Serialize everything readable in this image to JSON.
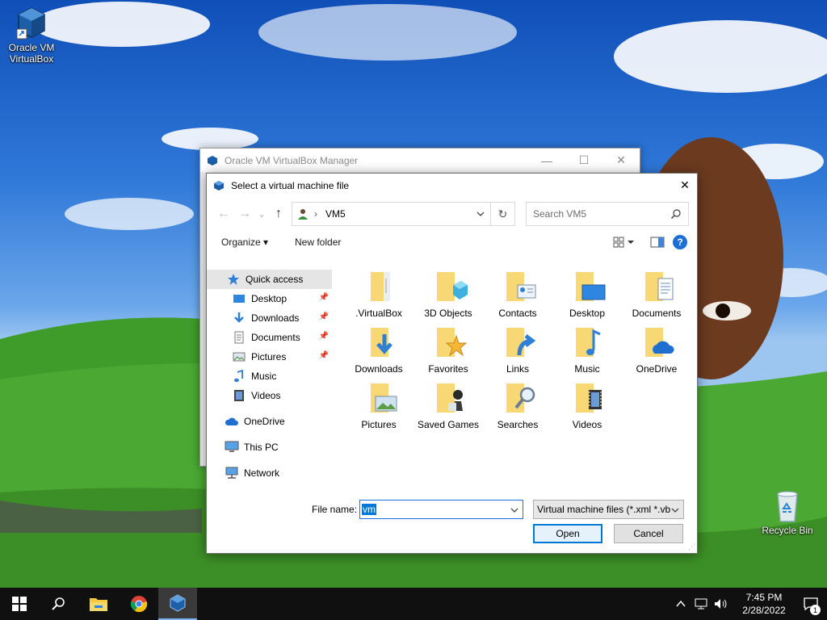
{
  "desktop": {
    "icons": [
      {
        "label": "Oracle VM VirtualBox",
        "icon": "virtualbox-icon"
      },
      {
        "label": "Recycle Bin",
        "icon": "recycle-bin-icon"
      }
    ]
  },
  "back_window": {
    "title": "Oracle VM VirtualBox Manager",
    "controls": {
      "minimize": "—",
      "maximize": "☐",
      "close": "✕"
    }
  },
  "dialog": {
    "title": "Select a virtual machine file",
    "close": "✕",
    "nav": {
      "back": "←",
      "forward": "→",
      "recent": "⌄",
      "up": "↑"
    },
    "address": {
      "separator": "›",
      "path": "VM5",
      "refresh": "↻"
    },
    "search": {
      "placeholder": "Search VM5"
    },
    "commands": {
      "organize": "Organize ▾",
      "new_folder": "New folder"
    },
    "nav_pane": [
      {
        "label": "Quick access",
        "icon": "star-icon",
        "pinned": false
      },
      {
        "label": "Desktop",
        "icon": "desktop-icon",
        "pinned": true
      },
      {
        "label": "Downloads",
        "icon": "download-icon",
        "pinned": true
      },
      {
        "label": "Documents",
        "icon": "document-icon",
        "pinned": true
      },
      {
        "label": "Pictures",
        "icon": "picture-icon",
        "pinned": true
      },
      {
        "label": "Music",
        "icon": "music-icon",
        "pinned": false
      },
      {
        "label": "Videos",
        "icon": "video-icon",
        "pinned": false
      },
      {
        "label": "OneDrive",
        "icon": "cloud-icon",
        "pinned": false
      },
      {
        "label": "This PC",
        "icon": "computer-icon",
        "pinned": false
      },
      {
        "label": "Network",
        "icon": "network-icon",
        "pinned": false
      }
    ],
    "folders": [
      {
        "label": ".VirtualBox",
        "icon": "folder-icon"
      },
      {
        "label": "3D Objects",
        "icon": "3d-objects-folder-icon"
      },
      {
        "label": "Contacts",
        "icon": "contacts-folder-icon"
      },
      {
        "label": "Desktop",
        "icon": "desktop-folder-icon"
      },
      {
        "label": "Documents",
        "icon": "documents-folder-icon"
      },
      {
        "label": "Downloads",
        "icon": "downloads-folder-icon"
      },
      {
        "label": "Favorites",
        "icon": "favorites-folder-icon"
      },
      {
        "label": "Links",
        "icon": "links-folder-icon"
      },
      {
        "label": "Music",
        "icon": "music-folder-icon"
      },
      {
        "label": "OneDrive",
        "icon": "onedrive-folder-icon"
      },
      {
        "label": "Pictures",
        "icon": "pictures-folder-icon"
      },
      {
        "label": "Saved Games",
        "icon": "saved-games-folder-icon"
      },
      {
        "label": "Searches",
        "icon": "searches-folder-icon"
      },
      {
        "label": "Videos",
        "icon": "videos-folder-icon"
      }
    ],
    "file_name": {
      "label": "File name:",
      "value": "vm"
    },
    "file_type": {
      "value": "Virtual machine files (*.xml *.vb"
    },
    "buttons": {
      "open": "Open",
      "cancel": "Cancel"
    }
  },
  "taskbar": {
    "time": "7:45 PM",
    "date": "2/28/2022",
    "notification_count": "1",
    "apps": [
      "start-icon",
      "search-icon",
      "file-explorer-icon",
      "chrome-icon",
      "virtualbox-icon"
    ]
  },
  "colors": {
    "accent": "#0078d7",
    "folder": "#f8d775",
    "taskbar": "#101010"
  }
}
